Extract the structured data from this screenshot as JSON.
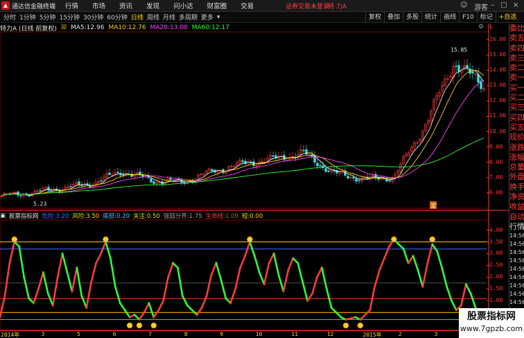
{
  "app": {
    "title": "通达信金融终端",
    "menu": [
      "行情",
      "市场",
      "资讯",
      "发现",
      "问小达",
      "财富圈",
      "交易"
    ],
    "notice": "证券交易未登录",
    "stock_name": "特 力A",
    "window_buttons": [
      "游客"
    ]
  },
  "toolbar": {
    "periods": [
      "分时",
      "1分钟",
      "5分钟",
      "15分钟",
      "30分钟",
      "60分钟",
      "日线",
      "周线",
      "月线",
      "多周期",
      "更多"
    ],
    "active_period": "日线",
    "tools": [
      "复权",
      "叠加",
      "多股",
      "统计",
      "画线",
      "F10",
      "标记",
      "+自选"
    ]
  },
  "chart_info": {
    "label": "特力A (日线 前复权)",
    "ma": [
      {
        "name": "MA5:",
        "value": "12.96",
        "color": "#e8e8e8"
      },
      {
        "name": "MA10:",
        "value": "12.76",
        "color": "#ffd200"
      },
      {
        "name": "MA20:",
        "value": "13.00",
        "color": "#ff44ff"
      },
      {
        "name": "MA60:",
        "value": "12.17",
        "color": "#32ff32"
      }
    ]
  },
  "side_panel": {
    "items": [
      "委比",
      "卖五",
      "卖四",
      "卖三",
      "卖二",
      "卖一",
      "买一",
      "买二",
      "买三",
      "买四",
      "买五",
      "现价",
      "涨跌",
      "涨幅",
      "总量",
      "外盘",
      "换手",
      "净资",
      "收益"
    ],
    "sub_items": [
      "自动",
      "行情",
      "14:56",
      "14:56",
      "14:56",
      "14:56",
      "14:56",
      "14:56",
      "14:56",
      "14:56",
      "14:56"
    ]
  },
  "indicator": {
    "name": "股票指标网",
    "fields": [
      {
        "label": "危险:",
        "value": "3.20",
        "color": "#3f6dff"
      },
      {
        "label": "风险:",
        "value": "3.50",
        "color": "#ffd200"
      },
      {
        "label": "底部:",
        "value": "0.20",
        "color": "#38c8ff"
      },
      {
        "label": "关注:",
        "value": "0.50",
        "color": "#ffd200"
      },
      {
        "label": "强弱分界:",
        "value": "1.75",
        "color": "#9a9a9a"
      },
      {
        "label": "生命线:",
        "value": "1.09",
        "color": "#ff3c3c"
      },
      {
        "label": "短:",
        "value": "0.00",
        "color": "#ffd200"
      }
    ]
  },
  "colors": {
    "up": "#ff3c3c",
    "down": "#32ff32",
    "background": "#000000",
    "grid": "#7a0000",
    "ma5": "#e8e8e8",
    "ma10": "#ffd200",
    "ma20": "#ff44ff",
    "ma60": "#32ff32"
  },
  "chart_data": [
    {
      "type": "candlestick",
      "title": "特力A (日线 前复权)",
      "y_ticks": [
        "16.00",
        "15.00",
        "14.00",
        "13.00",
        "12.00",
        "11.00",
        "10.00",
        "9.00",
        "8.00",
        "7.00",
        "6.00"
      ],
      "ylim": [
        5.0,
        16.5
      ],
      "annotations": [
        "5.23",
        "15.85"
      ],
      "ma_periods": [
        5,
        10,
        20,
        60
      ],
      "trend_close": [
        {
          "month": "2014-01",
          "close": 5.8
        },
        {
          "month": "2014-02",
          "close": 6.0
        },
        {
          "month": "2014-03",
          "close": 6.3
        },
        {
          "month": "2014-04",
          "close": 6.6
        },
        {
          "month": "2014-05",
          "close": 7.4
        },
        {
          "month": "2014-06",
          "close": 6.8
        },
        {
          "month": "2014-07",
          "close": 6.7
        },
        {
          "month": "2014-08",
          "close": 7.4
        },
        {
          "month": "2014-09",
          "close": 7.9
        },
        {
          "month": "2014-10",
          "close": 8.2
        },
        {
          "month": "2014-11",
          "close": 8.6
        },
        {
          "month": "2014-12",
          "close": 7.3
        },
        {
          "month": "2015-01",
          "close": 6.9
        },
        {
          "month": "2015-02",
          "close": 7.0
        },
        {
          "month": "2015-03",
          "close": 10.2
        },
        {
          "month": "2015-04",
          "close": 14.5
        },
        {
          "month": "2015-05",
          "close": 13.0
        }
      ],
      "grid": false,
      "marker_label": "定"
    },
    {
      "type": "line",
      "title": "股票指标网",
      "y_ticks": [
        "4.00",
        "3.50",
        "3.00",
        "2.50",
        "2.00",
        "1.50",
        "1.00",
        "0.50"
      ],
      "ylim": [
        -0.2,
        4.4
      ],
      "horizontal_lines": [
        {
          "label": "风险",
          "value": 3.5,
          "color": "#ffd200"
        },
        {
          "label": "危险",
          "value": 3.2,
          "color": "#3f6dff"
        },
        {
          "label": "强弱分界",
          "value": 1.75,
          "color": "#9a9a9a"
        },
        {
          "label": "生命线",
          "value": 1.09,
          "color": "#ff3c3c"
        },
        {
          "label": "关注",
          "value": 0.5,
          "color": "#ffd200"
        },
        {
          "label": "底部",
          "value": 0.2,
          "color": "#38c8ff"
        }
      ],
      "series": [
        {
          "name": "短",
          "values": [
            0.3,
            1.2,
            2.6,
            3.5,
            3.3,
            2.0,
            1.1,
            0.9,
            1.5,
            2.2,
            1.3,
            0.8,
            2.0,
            3.0,
            2.2,
            1.4,
            2.4,
            1.2,
            0.7,
            1.8,
            2.6,
            3.0,
            3.5,
            2.8,
            1.6,
            0.9,
            0.6,
            0.3,
            0.4,
            0.2,
            0.5,
            0.9,
            0.3,
            0.6,
            1.0,
            2.0,
            2.6,
            2.4,
            1.2,
            0.8,
            0.6,
            0.4,
            0.7,
            1.2,
            2.1,
            2.6,
            1.9,
            1.1,
            0.9,
            1.5,
            2.4,
            2.9,
            3.5,
            2.9,
            2.2,
            1.7,
            2.6,
            3.0,
            2.1,
            1.4,
            2.3,
            2.8,
            2.6,
            1.8,
            1.0,
            1.3,
            2.0,
            2.4,
            1.5,
            0.7,
            0.5,
            0.3,
            0.2,
            0.25,
            0.3,
            0.2,
            0.4,
            0.6,
            1.6,
            2.3,
            2.8,
            3.3,
            3.6,
            3.4,
            3.2,
            2.6,
            2.9,
            2.3,
            1.6,
            2.6,
            3.4,
            3.1,
            2.4,
            1.6,
            1.0,
            0.6,
            0.8,
            1.7,
            1.3,
            0.7,
            0.3,
            0.2
          ]
        }
      ],
      "signals": {
        "top_marks": 5,
        "bottom_marks": 7
      }
    }
  ],
  "date_axis": [
    "2014年",
    "3",
    "5",
    "6",
    "7",
    "8",
    "9",
    "10",
    "11",
    "12",
    "2015年",
    "2",
    "3",
    "4"
  ],
  "watermark": {
    "line1": "股票指标网",
    "line2": "www.7gpzb.com"
  }
}
